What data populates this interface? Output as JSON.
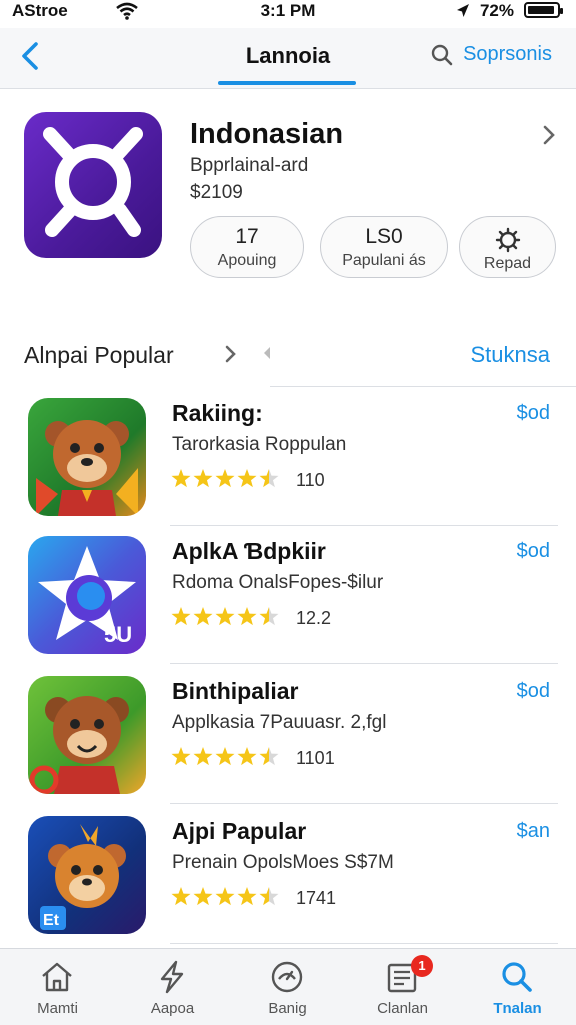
{
  "status_bar": {
    "carrier": "AStroe",
    "time": "3:1 PM",
    "battery": "72%"
  },
  "nav": {
    "title": "Lannoia",
    "search_label": "Soprsonis"
  },
  "app": {
    "title": "Indonasian",
    "subtitle": "Bpprlainal-ard",
    "price": "$2109",
    "pills": [
      {
        "value": "17",
        "label": "Apouing"
      },
      {
        "value": "LS0",
        "label": "Papulani ás"
      },
      {
        "label": "Repad"
      }
    ]
  },
  "section": {
    "title": "Alnpai Popular",
    "link": "Stuknsa"
  },
  "list": [
    {
      "name": "Rakiing:",
      "desc": "Tarorkasia Roppulan",
      "rating": 4.5,
      "count": "110",
      "price": "$od"
    },
    {
      "name": "AplkA Ɓdpkiir",
      "desc": "Rdoma OnalsFopes-$ilur",
      "rating": 4.5,
      "count": "12.2",
      "price": "$od"
    },
    {
      "name": "Binthipaliar",
      "desc": "Applkasia 7Pauuasr. 2,fgl",
      "rating": 4.5,
      "count": "1101",
      "price": "$od"
    },
    {
      "name": "Ajpi Papular",
      "desc": "Prenain OpolsMoes S$7M",
      "rating": 4.5,
      "count": "1741",
      "price": "$an"
    }
  ],
  "tabs": [
    {
      "label": "Mamti",
      "icon": "home-icon"
    },
    {
      "label": "Aapoa",
      "icon": "lightning-icon"
    },
    {
      "label": "Banig",
      "icon": "gauge-icon"
    },
    {
      "label": "Clanlan",
      "icon": "news-icon",
      "badge": "1"
    },
    {
      "label": "Tnalan",
      "icon": "search-icon",
      "active": true
    }
  ],
  "colors": {
    "accent": "#1a8fe3",
    "star": "#f5c518",
    "app_icon": "#5a22b4",
    "badge": "#e8281f"
  }
}
